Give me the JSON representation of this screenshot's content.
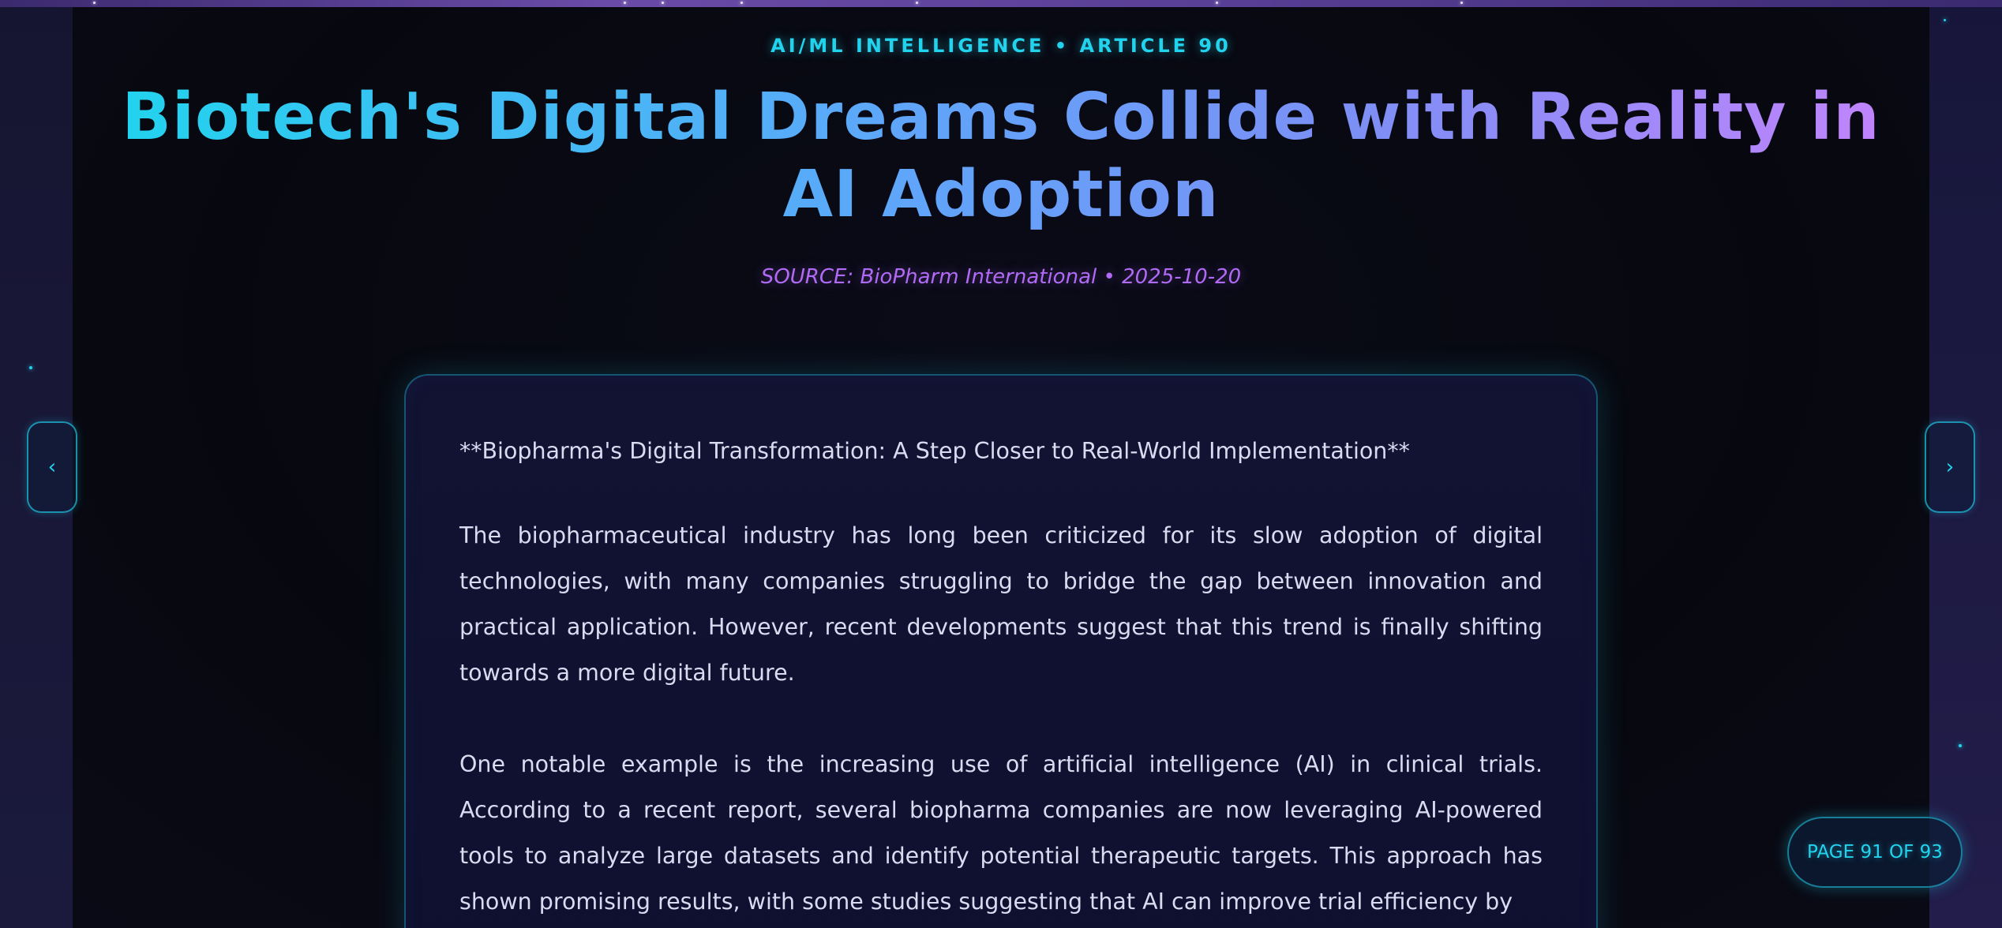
{
  "kicker": "AI/ML INTELLIGENCE • ARTICLE 90",
  "title": "Biotech's Digital Dreams Collide with Reality in AI Adoption",
  "source": "SOURCE: BioPharm International • 2025-10-20",
  "article": {
    "heading": "**Biopharma's Digital Transformation: A Step Closer to Real-World Implementation**",
    "paragraphs": [
      "The biopharmaceutical industry has long been criticized for its slow adoption of digital technologies, with many companies struggling to bridge the gap between innovation and practical application. However, recent developments suggest that this trend is finally shifting towards a more digital future.",
      "One notable example is the increasing use of artificial intelligence (AI) in clinical trials. According to a recent report, several biopharma companies are now leveraging AI-powered tools to analyze large datasets and identify potential therapeutic targets. This approach has shown promising results, with some studies suggesting that AI can improve trial efficiency by"
    ]
  },
  "nav": {
    "prev_label": "‹",
    "next_label": "›"
  },
  "pagination": {
    "label": "PAGE 91 OF 93",
    "current": 91,
    "total": 93
  },
  "colors": {
    "accent_cyan": "#22d3ee",
    "accent_purple": "#c084fc",
    "source_purple": "#b06af5",
    "background": "#07080f",
    "body_text": "#d8dcf0"
  }
}
